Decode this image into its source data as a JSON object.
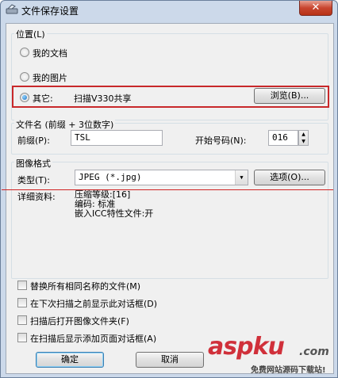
{
  "window": {
    "title": "文件保存设置",
    "close_glyph": "✕"
  },
  "location": {
    "group_label": "位置(L)",
    "options": [
      {
        "label": "我的文档",
        "checked": false
      },
      {
        "label": "我的图片",
        "checked": false
      },
      {
        "label": "其它:",
        "checked": true
      }
    ],
    "other_path": "扫描V330共享",
    "browse_label": "浏览(B)..."
  },
  "filename": {
    "group_label": "文件名 (前缀 + 3位数字)",
    "prefix_label": "前缀(P):",
    "prefix_value": "TSL",
    "start_label": "开始号码(N):",
    "start_value": "016"
  },
  "format": {
    "group_label": "图像格式",
    "type_label": "类型(T):",
    "type_value": "JPEG (*.jpg)",
    "options_label": "选项(O)...",
    "details_label": "详细资料:",
    "details": [
      "压缩等级:[16]",
      "编码: 标准",
      "嵌入ICC特性文件:开"
    ]
  },
  "checkboxes": [
    {
      "label": "替换所有相同名称的文件(M)",
      "checked": false
    },
    {
      "label": "在下次扫描之前显示此对话框(D)",
      "checked": false
    },
    {
      "label": "扫描后打开图像文件夹(F)",
      "checked": false
    },
    {
      "label": "在扫描后显示添加页面对话框(A)",
      "checked": false
    }
  ],
  "buttons": {
    "ok": "确定",
    "cancel": "取消"
  },
  "watermark": {
    "brand": "aspku",
    "tld": ".com",
    "tagline": "免费网站源码下载站!"
  },
  "colors": {
    "highlight": "#c8282a",
    "accent": "#1f6fbf"
  }
}
